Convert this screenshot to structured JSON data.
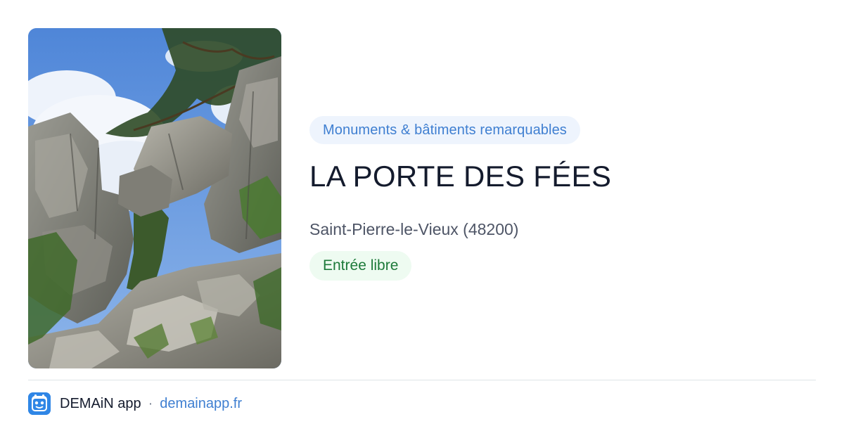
{
  "photo": {
    "icon": "rock-formation-photo",
    "sky_color": "#5f95dd"
  },
  "category": "Monuments & bâtiments remarquables",
  "title": "LA PORTE DES FÉES",
  "location": "Saint-Pierre-le-Vieux (48200)",
  "access": "Entrée libre",
  "footer": {
    "app_name": "DEMAiN app",
    "separator": "·",
    "link": "demainapp.fr",
    "logo_icon": "demain-app-logo-icon"
  },
  "colors": {
    "category_pill_bg": "#eef4fd",
    "category_pill_text": "#3f7fd1",
    "access_pill_bg": "#eefbf1",
    "access_pill_text": "#1d7a3a",
    "title_text": "#141b2d",
    "link": "#3f7fd1"
  }
}
